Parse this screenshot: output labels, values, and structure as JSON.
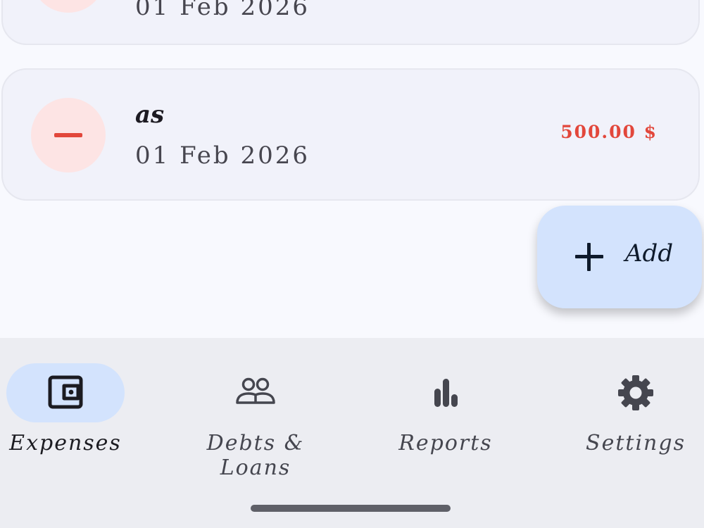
{
  "transactions": [
    {
      "title": "",
      "date": "01 Feb 2026",
      "amount": ""
    },
    {
      "title": "as",
      "date": "01 Feb 2026",
      "amount": "500.00 $"
    }
  ],
  "fab": {
    "label": "Add",
    "icon": "plus-icon"
  },
  "nav": {
    "items": [
      {
        "label": "Expenses",
        "icon": "wallet-icon",
        "active": true
      },
      {
        "label": "Debts & Loans",
        "icon": "people-icon",
        "active": false
      },
      {
        "label": "Reports",
        "icon": "bar-chart-icon",
        "active": false
      },
      {
        "label": "Settings",
        "icon": "gear-icon",
        "active": false
      }
    ]
  },
  "colors": {
    "expense_red": "#e2473b",
    "accent_blue": "#d3e3fd",
    "card_bg": "#f1f2fa",
    "nav_bg": "#ecedf2"
  }
}
